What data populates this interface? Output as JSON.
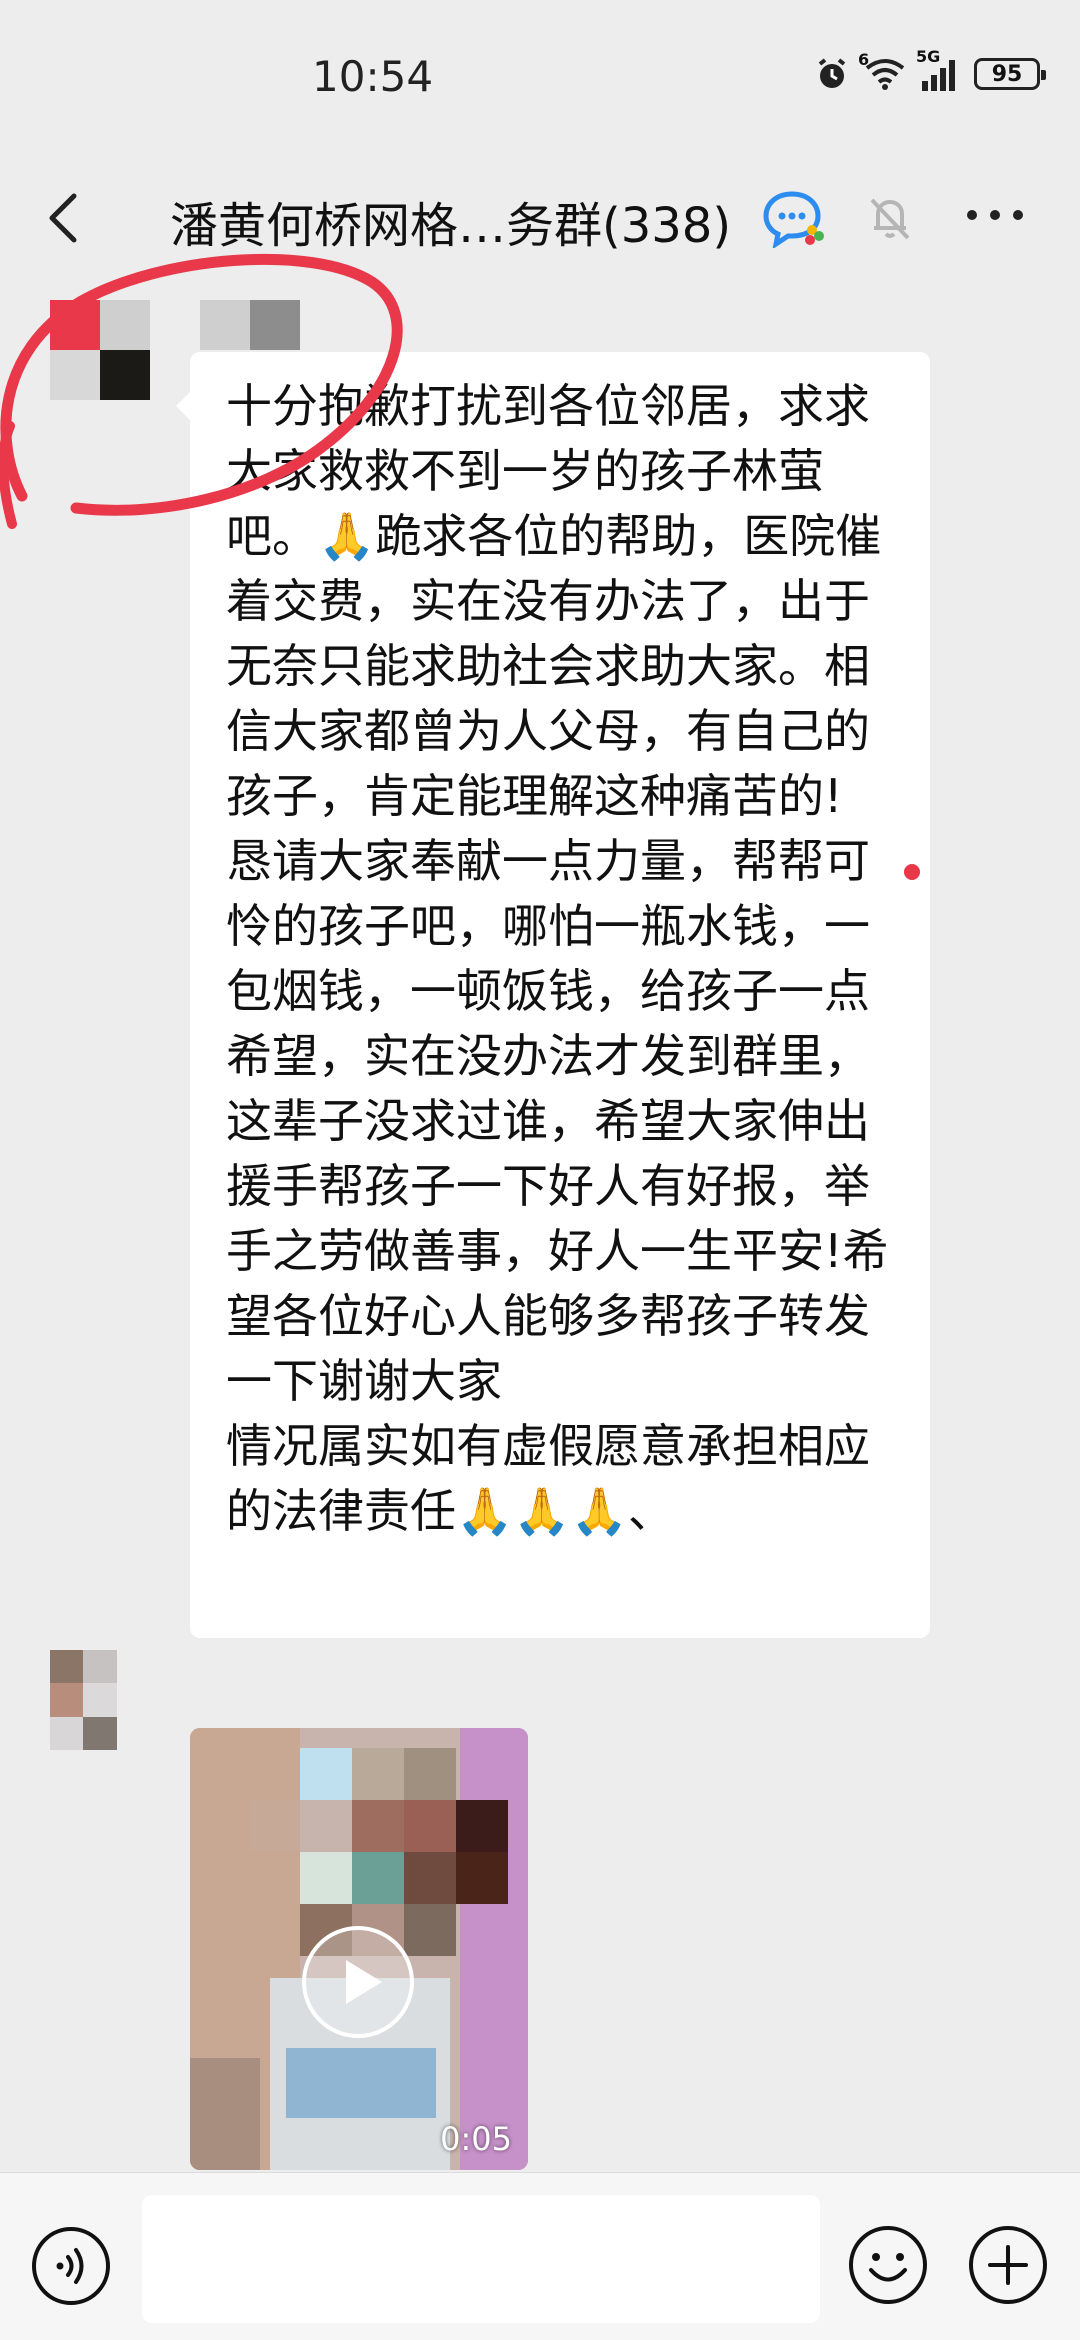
{
  "status_bar": {
    "time": "10:54",
    "network_label": "5G",
    "signal_label": "6",
    "battery": "95",
    "icons": [
      "alarm-icon",
      "wifi-icon",
      "cellular-signal-icon",
      "battery-icon"
    ]
  },
  "header": {
    "title": "潘黄何桥网格…务群(338)",
    "icons": [
      "back-icon",
      "group-chat-badge-icon",
      "mute-bell-icon",
      "more-icon"
    ]
  },
  "messages": [
    {
      "type": "text",
      "sender_avatar": "blurred-avatar",
      "text": "十分抱歉打扰到各位邻居，求求大家救救不到一岁的孩子林萤吧。🙏跪求各位的帮助，医院催着交费，实在没有办法了，出于无奈只能求助社会求助大家。相信大家都曾为人父母，有自己的孩子，肯定能理解这种痛苦的! 恳请大家奉献一点力量，帮帮可怜的孩子吧，哪怕一瓶水钱，一包烟钱，一顿饭钱，给孩子一点希望，实在没办法才发到群里，这辈子没求过谁，希望大家伸出援手帮孩子一下好人有好报，举手之劳做善事，好人一生平安!希望各位好心人能够多帮孩子转发一下谢谢大家\n情况属实如有虚假愿意承担相应的法律责任🙏🙏🙏、"
    },
    {
      "type": "video",
      "sender_avatar": "blurred-avatar",
      "duration": "0:05"
    }
  ],
  "input_bar": {
    "placeholder": "",
    "icons": [
      "voice-icon",
      "emoji-icon",
      "plus-icon"
    ]
  },
  "colors": {
    "background": "#ededed",
    "bubble": "#ffffff",
    "highlight_circle": "#e8384a",
    "unread_dot": "#e8384a"
  }
}
